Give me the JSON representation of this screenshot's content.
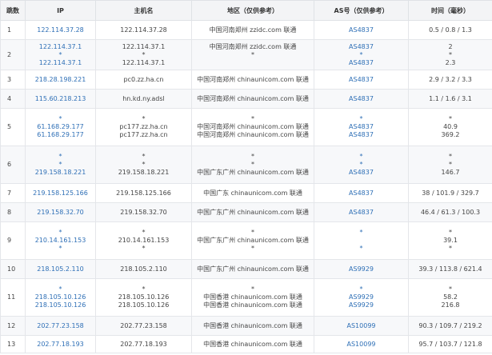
{
  "headers": [
    "跳数",
    "IP",
    "主机名",
    "地区（仅供参考）",
    "AS号（仅供参考）",
    "时间（毫秒）"
  ],
  "rows": [
    {
      "hop": "1",
      "ip": [
        "122.114.37.28"
      ],
      "host": [
        "122.114.37.28"
      ],
      "region": [
        "中国河南郑州 zzidc.com 联通"
      ],
      "as": [
        "AS4837"
      ],
      "time": [
        "0.5 / 0.8 / 1.3"
      ]
    },
    {
      "hop": "2",
      "ip": [
        "122.114.37.1",
        "*",
        "122.114.37.1"
      ],
      "host": [
        "122.114.37.1",
        "*",
        "122.114.37.1"
      ],
      "region": [
        "中国河南郑州 zzidc.com 联通",
        "*",
        ""
      ],
      "as": [
        "AS4837",
        "*",
        "AS4837"
      ],
      "time": [
        "2",
        "*",
        "2.3"
      ]
    },
    {
      "hop": "3",
      "ip": [
        "218.28.198.221"
      ],
      "host": [
        "pc0.zz.ha.cn"
      ],
      "region": [
        "中国河南郑州 chinaunicom.com 联通"
      ],
      "as": [
        "AS4837"
      ],
      "time": [
        "2.9 / 3.2 / 3.3"
      ]
    },
    {
      "hop": "4",
      "ip": [
        "115.60.218.213"
      ],
      "host": [
        "hn.kd.ny.adsl"
      ],
      "region": [
        "中国河南郑州 chinaunicom.com 联通"
      ],
      "as": [
        "AS4837"
      ],
      "time": [
        "1.1 / 1.6 / 3.1"
      ]
    },
    {
      "hop": "5",
      "ip": [
        "*",
        "61.168.29.177",
        "61.168.29.177"
      ],
      "host": [
        "*",
        "pc177.zz.ha.cn",
        "pc177.zz.ha.cn"
      ],
      "region": [
        "*",
        "中国河南郑州 chinaunicom.com 联通",
        "中国河南郑州 chinaunicom.com 联通"
      ],
      "as": [
        "*",
        "AS4837",
        "AS4837"
      ],
      "time": [
        "*",
        "40.9",
        "369.2"
      ]
    },
    {
      "hop": "6",
      "ip": [
        "*",
        "*",
        "219.158.18.221"
      ],
      "host": [
        "*",
        "*",
        "219.158.18.221"
      ],
      "region": [
        "*",
        "*",
        "中国广东广州 chinaunicom.com 联通"
      ],
      "as": [
        "*",
        "*",
        "AS4837"
      ],
      "time": [
        "*",
        "*",
        "146.7"
      ]
    },
    {
      "hop": "7",
      "ip": [
        "219.158.125.166"
      ],
      "host": [
        "219.158.125.166"
      ],
      "region": [
        "中国广东 chinaunicom.com 联通"
      ],
      "as": [
        "AS4837"
      ],
      "time": [
        "38 / 101.9 / 329.7"
      ]
    },
    {
      "hop": "8",
      "ip": [
        "219.158.32.70"
      ],
      "host": [
        "219.158.32.70"
      ],
      "region": [
        "中国广东广州 chinaunicom.com 联通"
      ],
      "as": [
        "AS4837"
      ],
      "time": [
        "46.4 / 61.3 / 100.3"
      ]
    },
    {
      "hop": "9",
      "ip": [
        "*",
        "210.14.161.153",
        "*"
      ],
      "host": [
        "*",
        "210.14.161.153",
        "*"
      ],
      "region": [
        "*",
        "中国广东广州 chinaunicom.com 联通",
        "*"
      ],
      "as": [
        "*",
        "",
        "*"
      ],
      "time": [
        "*",
        "39.1",
        "*"
      ]
    },
    {
      "hop": "10",
      "ip": [
        "218.105.2.110"
      ],
      "host": [
        "218.105.2.110"
      ],
      "region": [
        "中国广东广州 chinaunicom.com 联通"
      ],
      "as": [
        "AS9929"
      ],
      "time": [
        "39.3 / 113.8 / 621.4"
      ]
    },
    {
      "hop": "11",
      "ip": [
        "*",
        "218.105.10.126",
        "218.105.10.126"
      ],
      "host": [
        "*",
        "218.105.10.126",
        "218.105.10.126"
      ],
      "region": [
        "*",
        "中国香港 chinaunicom.com 联通",
        "中国香港 chinaunicom.com 联通"
      ],
      "as": [
        "*",
        "AS9929",
        "AS9929"
      ],
      "time": [
        "*",
        "58.2",
        "216.8"
      ]
    },
    {
      "hop": "12",
      "ip": [
        "202.77.23.158"
      ],
      "host": [
        "202.77.23.158"
      ],
      "region": [
        "中国香港 chinaunicom.com 联通"
      ],
      "as": [
        "AS10099"
      ],
      "time": [
        "90.3 / 109.7 / 219.2"
      ]
    },
    {
      "hop": "13",
      "ip": [
        "202.77.18.193"
      ],
      "host": [
        "202.77.18.193"
      ],
      "region": [
        "中国香港 chinaunicom.com 联通"
      ],
      "as": [
        "AS10099"
      ],
      "time": [
        "95.7 / 103.7 / 121.8"
      ]
    }
  ],
  "colors": {
    "link": "#2e6fb6",
    "header_bg": "#f3f4f6",
    "border": "#e4e6ea"
  }
}
